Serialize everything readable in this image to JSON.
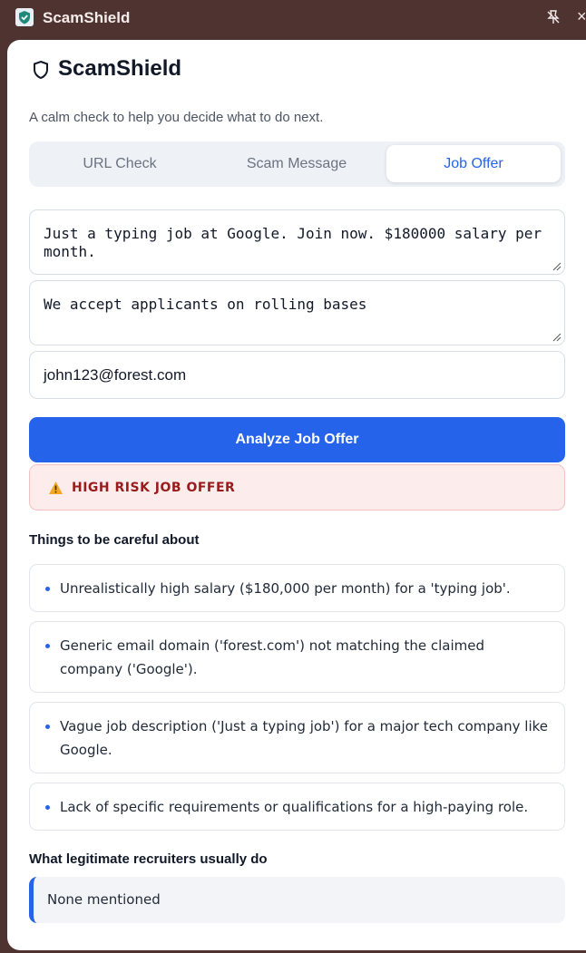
{
  "window": {
    "title": "ScamShield"
  },
  "app": {
    "title": "ScamShield",
    "subtitle": "A calm check to help you decide what to do next."
  },
  "tabs": [
    {
      "label": "URL Check",
      "active": false
    },
    {
      "label": "Scam Message",
      "active": false
    },
    {
      "label": "Job Offer",
      "active": true
    }
  ],
  "form": {
    "job_description": "Just a typing job at Google. Join now. $180000 salary per month.",
    "extra_details": "We accept applicants on rolling bases",
    "recruiter_email": "john123@forest.com",
    "analyze_label": "Analyze Job Offer"
  },
  "result": {
    "risk_label": "HIGH RISK JOB OFFER",
    "risk_icon": "warning-icon",
    "careful_heading": "Things to be careful about",
    "careful_items": [
      "Unrealistically high salary ($180,000 per month) for a 'typing job'.",
      "Generic email domain ('forest.com') not matching the claimed company ('Google').",
      "Vague job description ('Just a typing job') for a major tech company like Google.",
      "Lack of specific requirements or qualifications for a high-paying role."
    ],
    "legit_heading": "What legitimate recruiters usually do",
    "legit_text": "None mentioned"
  },
  "colors": {
    "accent": "#2563eb",
    "danger_bg": "#fdecec",
    "danger_text": "#991b1b",
    "window_frame": "#4f3330"
  }
}
